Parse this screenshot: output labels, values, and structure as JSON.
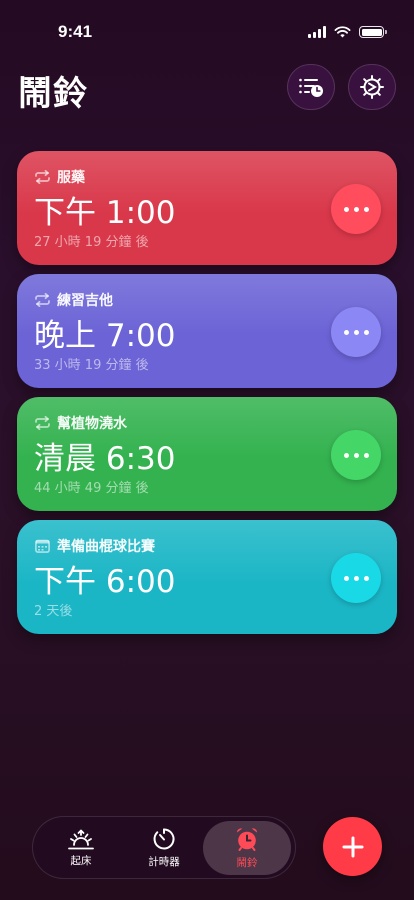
{
  "status_bar": {
    "time": "9:41"
  },
  "header": {
    "title": "鬧鈴"
  },
  "alarms": [
    {
      "label": "服藥",
      "icon": "repeat-icon",
      "time": "下午 1:00",
      "remaining": "27 小時 19 分鐘 後",
      "color": "#d9384a"
    },
    {
      "label": "練習吉他",
      "icon": "repeat-icon",
      "time": "晚上 7:00",
      "remaining": "33 小時 19 分鐘 後",
      "color": "#6b63d6"
    },
    {
      "label": "幫植物澆水",
      "icon": "repeat-icon",
      "time": "清晨 6:30",
      "remaining": "44 小時 49 分鐘 後",
      "color": "#33b24f"
    },
    {
      "label": "準備曲棍球比賽",
      "icon": "calendar-icon",
      "time": "下午 6:00",
      "remaining": "2 天後",
      "color": "#1bb6c6"
    }
  ],
  "tabs": [
    {
      "label": "起床",
      "icon": "sunrise-icon"
    },
    {
      "label": "計時器",
      "icon": "timer-icon"
    },
    {
      "label": "鬧鈴",
      "icon": "alarm-clock-icon",
      "selected": true
    }
  ],
  "colors": {
    "accent": "#ff3b47",
    "background": "#2a0f2c"
  }
}
